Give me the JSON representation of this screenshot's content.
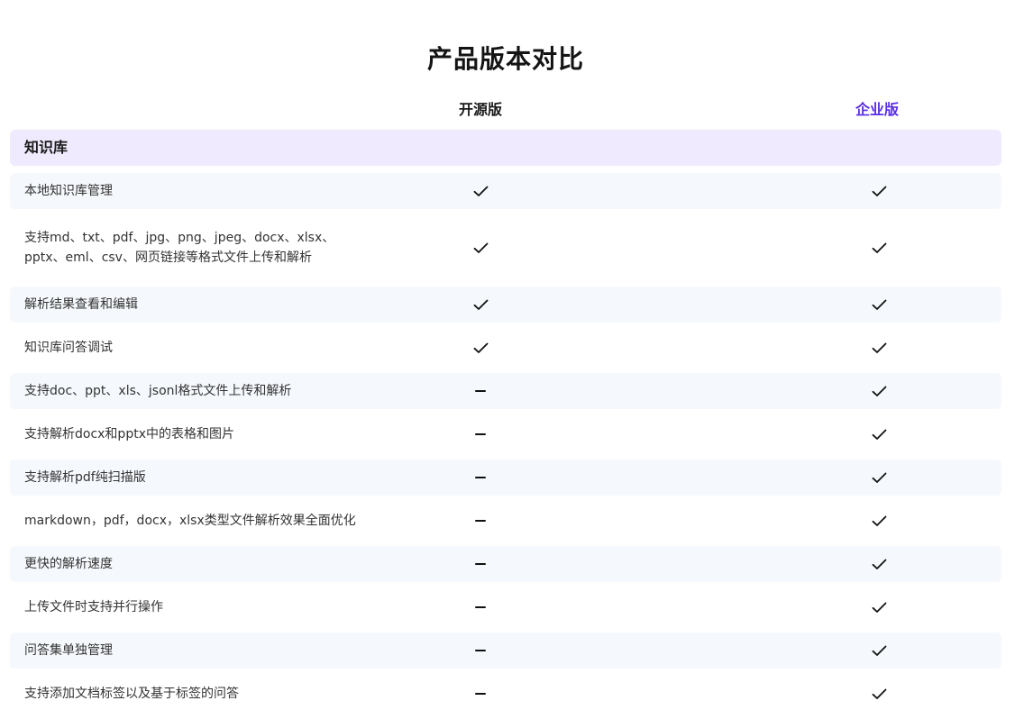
{
  "page_title": "产品版本对比",
  "columns": {
    "open_source": "开源版",
    "enterprise": "企业版"
  },
  "colors": {
    "enterprise_accent": "#5b2ee6",
    "section_bg": "#efeafd",
    "row_alt_bg": "#f5f8fc"
  },
  "section": {
    "label": "知识库"
  },
  "rows": [
    {
      "feature": "本地知识库管理",
      "open_source": "check",
      "enterprise": "check"
    },
    {
      "feature": "支持md、txt、pdf、jpg、png、jpeg、docx、xlsx、pptx、eml、csv、网页链接等格式文件上传和解析",
      "open_source": "check",
      "enterprise": "check"
    },
    {
      "feature": "解析结果查看和编辑",
      "open_source": "check",
      "enterprise": "check"
    },
    {
      "feature": "知识库问答调试",
      "open_source": "check",
      "enterprise": "check"
    },
    {
      "feature": "支持doc、ppt、xls、jsonl格式文件上传和解析",
      "open_source": "dash",
      "enterprise": "check"
    },
    {
      "feature": "支持解析docx和pptx中的表格和图片",
      "open_source": "dash",
      "enterprise": "check"
    },
    {
      "feature": "支持解析pdf纯扫描版",
      "open_source": "dash",
      "enterprise": "check"
    },
    {
      "feature": "markdown，pdf，docx，xlsx类型文件解析效果全面优化",
      "open_source": "dash",
      "enterprise": "check"
    },
    {
      "feature": "更快的解析速度",
      "open_source": "dash",
      "enterprise": "check"
    },
    {
      "feature": "上传文件时支持并行操作",
      "open_source": "dash",
      "enterprise": "check"
    },
    {
      "feature": "问答集单独管理",
      "open_source": "dash",
      "enterprise": "check"
    },
    {
      "feature": "支持添加文档标签以及基于标签的问答",
      "open_source": "dash",
      "enterprise": "check"
    }
  ]
}
